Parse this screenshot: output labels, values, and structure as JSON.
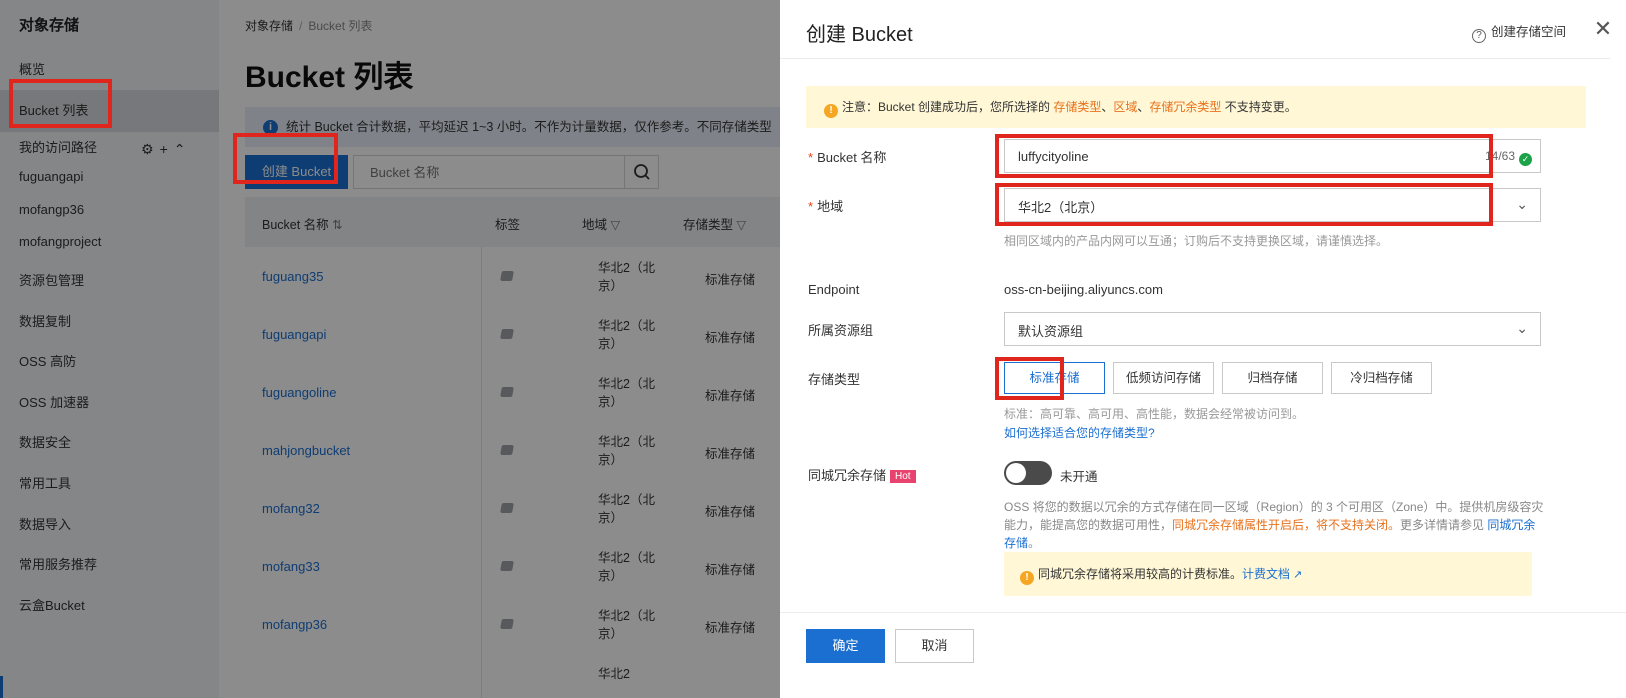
{
  "sidebar": {
    "title": "对象存储",
    "items": [
      "概览",
      "Bucket 列表"
    ],
    "paths_title": "我的访问路径",
    "paths": [
      "fuguangapi",
      "mofangp36",
      "mofangproject"
    ],
    "items2": [
      "资源包管理",
      "数据复制",
      "OSS 高防",
      "OSS 加速器",
      "数据安全",
      "常用工具",
      "数据导入",
      "常用服务推荐",
      "云盒Bucket"
    ]
  },
  "main": {
    "breadcrumb": [
      "对象存储",
      "Bucket 列表"
    ],
    "title": "Bucket 列表",
    "info": "统计 Bucket 合计数据，平均延迟 1~3 小时。不作为计量数据，仅作参考。不同存储类型",
    "create_button": "创建 Bucket",
    "search_placeholder": "Bucket 名称",
    "columns": [
      "Bucket 名称",
      "标签",
      "地域",
      "存储类型"
    ],
    "rows": [
      {
        "name": "fuguang35",
        "region": "华北2（北京）",
        "type": "标准存储"
      },
      {
        "name": "fuguangapi",
        "region": "华北2（北京）",
        "type": "标准存储"
      },
      {
        "name": "fuguangoline",
        "region": "华北2（北京）",
        "type": "标准存储"
      },
      {
        "name": "mahjongbucket",
        "region": "华北2（北京）",
        "type": "标准存储"
      },
      {
        "name": "mofang32",
        "region": "华北2（北京）",
        "type": "标准存储"
      },
      {
        "name": "mofang33",
        "region": "华北2（北京）",
        "type": "标准存储"
      },
      {
        "name": "mofangp36",
        "region": "华北2（北京）",
        "type": "标准存储"
      },
      {
        "name": "",
        "region": "华北2",
        "type": ""
      }
    ]
  },
  "drawer": {
    "title": "创建 Bucket",
    "help_link": "创建存储空间",
    "notice_prefix": "注意：Bucket 创建成功后，您所选择的 ",
    "notice_k1": "存储类型",
    "notice_sep1": "、",
    "notice_k2": "区域",
    "notice_sep2": "、",
    "notice_k3": "存储冗余类型",
    "notice_suffix": " 不支持变更。",
    "bucket_name_label": "Bucket 名称",
    "bucket_name_value": "luffycityoline",
    "bucket_name_counter": "14/63",
    "region_label": "地域",
    "region_value": "华北2（北京）",
    "region_hint": "相同区域内的产品内网可以互通；订购后不支持更换区域，请谨慎选择。",
    "endpoint_label": "Endpoint",
    "endpoint_value": "oss-cn-beijing.aliyuncs.com",
    "resource_group_label": "所属资源组",
    "resource_group_value": "默认资源组",
    "storage_type_label": "存储类型",
    "storage_types": [
      "标准存储",
      "低频访问存储",
      "归档存储",
      "冷归档存储"
    ],
    "storage_type_selected": "标准存储",
    "storage_hint": "标准：高可靠、高可用、高性能，数据会经常被访问到。",
    "storage_help_link": "如何选择适合您的存储类型?",
    "redundancy_label": "同城冗余存储",
    "hot_badge": "Hot",
    "redundancy_status": "未开通",
    "redundancy_para_a": "OSS 将您的数据以冗余的方式存储在同一区域（Region）的 3 个可用区（Zone）中。提供机房级容灾能力，能提高您的数据可用性，",
    "redundancy_para_b": "同城冗余存储属性开启后，将不支持关闭。",
    "redundancy_para_c": "更多详情请参见 ",
    "redundancy_para_link": "同城冗余存储",
    "redundancy_para_end": "。",
    "billing_notice": "同城冗余存储将采用较高的计费标准。",
    "billing_link": "计费文档",
    "ok_button": "确定",
    "cancel_button": "取消"
  },
  "colors": {
    "primary": "#1b6fd1",
    "highlight": "#e0261c",
    "warning": "#e8711c",
    "success": "#1ca34a",
    "hot": "#e8436e"
  }
}
